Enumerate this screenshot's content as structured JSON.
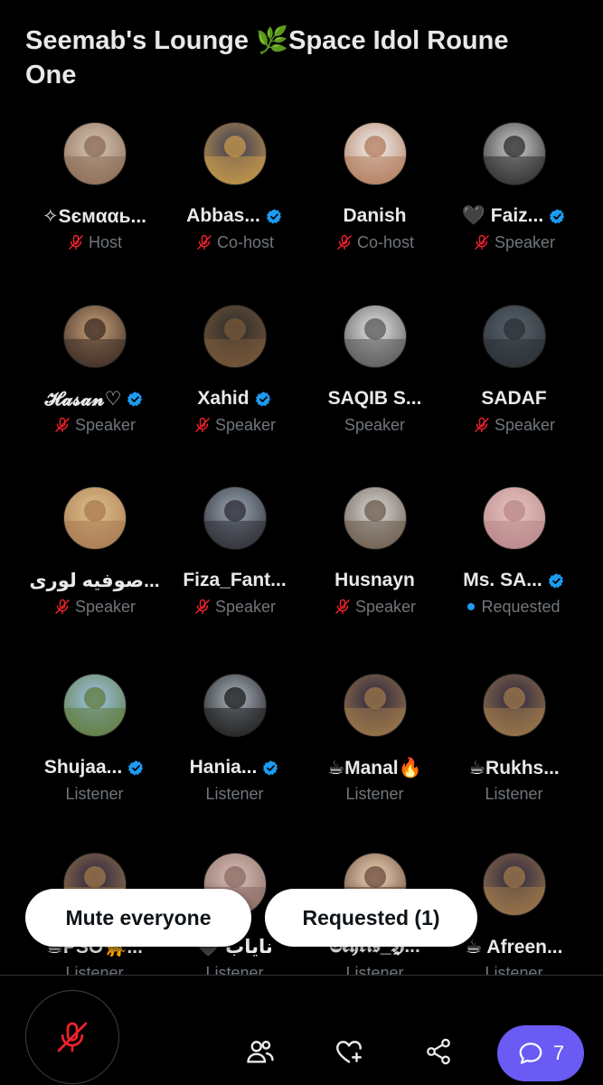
{
  "space": {
    "title": "Seemab's Lounge 🌿Space Idol Roune One"
  },
  "participants": [
    [
      {
        "name": "✧Ѕємααь...",
        "role": "Host",
        "verified": false,
        "status": "mic-off",
        "colors": [
          "#d8c7b6",
          "#8a6a54"
        ]
      },
      {
        "name": "Abbas...",
        "role": "Co-host",
        "verified": true,
        "status": "mic-off",
        "colors": [
          "#3a3a55",
          "#c89a4a"
        ]
      },
      {
        "name": "Danish",
        "role": "Co-host",
        "verified": false,
        "status": "mic-off",
        "colors": [
          "#f2f2f2",
          "#b07a5a"
        ]
      },
      {
        "name": "🖤 Faiz...",
        "role": "Speaker",
        "verified": true,
        "status": "mic-off",
        "colors": [
          "#d0d0d0",
          "#2a2a2a"
        ]
      }
    ],
    [
      {
        "name": "𝓗𝓪𝓼𝓪𝓷♡",
        "role": "Speaker",
        "verified": true,
        "status": "mic-off",
        "colors": [
          "#c9a27a",
          "#3a2a22"
        ]
      },
      {
        "name": "Xahid",
        "role": "Speaker",
        "verified": true,
        "status": "mic-off",
        "colors": [
          "#2b2b2b",
          "#7a5a3a"
        ]
      },
      {
        "name": "SAQIB S...",
        "role": "Speaker",
        "verified": false,
        "status": "none",
        "colors": [
          "#e6e6e6",
          "#555555"
        ]
      },
      {
        "name": "SADAF",
        "role": "Speaker",
        "verified": false,
        "status": "mic-off",
        "colors": [
          "#5a6570",
          "#2a2f33"
        ]
      }
    ],
    [
      {
        "name": "صوفيه لوری...",
        "role": "Speaker",
        "verified": false,
        "status": "mic-off",
        "colors": [
          "#e0c08a",
          "#a87a52"
        ]
      },
      {
        "name": "Fiza_Fant...",
        "role": "Speaker",
        "verified": false,
        "status": "mic-off",
        "colors": [
          "#9aa8b5",
          "#2b2b33"
        ]
      },
      {
        "name": "Husnayn",
        "role": "Speaker",
        "verified": false,
        "status": "mic-off",
        "colors": [
          "#d9d9d9",
          "#6a5a4a"
        ]
      },
      {
        "name": "Ms. SA...",
        "role": "Requested",
        "verified": true,
        "status": "requested",
        "colors": [
          "#e8c6c0",
          "#b8868a"
        ]
      }
    ],
    [
      {
        "name": "Shujaa...",
        "role": "Listener",
        "verified": true,
        "status": "none",
        "colors": [
          "#9ec4e8",
          "#5f7a3a"
        ]
      },
      {
        "name": "Hania...",
        "role": "Listener",
        "verified": true,
        "status": "none",
        "colors": [
          "#aeb7c2",
          "#1a1a1a"
        ]
      },
      {
        "name": "☕Manal🔥",
        "role": "Listener",
        "verified": false,
        "status": "none",
        "colors": [
          "#2a2540",
          "#a07a4a"
        ]
      },
      {
        "name": "☕Rukhs...",
        "role": "Listener",
        "verified": false,
        "status": "none",
        "colors": [
          "#2a2540",
          "#a07a4a"
        ]
      }
    ],
    [
      {
        "name": "☕PSO🐆...",
        "role": "Listener",
        "verified": false,
        "status": "none",
        "colors": [
          "#2a2540",
          "#a07a4a"
        ]
      },
      {
        "name": "🖤 نایاب",
        "role": "Listener",
        "verified": false,
        "status": "none",
        "colors": [
          "#d8c0b8",
          "#8a6a62"
        ]
      },
      {
        "name": "𝕾𝖊𝖍𝖗𝖎𝖘_𝕳...",
        "role": "Listener",
        "verified": false,
        "status": "none",
        "colors": [
          "#f0d6b8",
          "#6a4a3a"
        ]
      },
      {
        "name": "☕ Afreen...",
        "role": "Listener",
        "verified": false,
        "status": "none",
        "colors": [
          "#2a2540",
          "#a07a4a"
        ]
      }
    ]
  ],
  "actions": {
    "mute_everyone": "Mute everyone",
    "requested": "Requested (1)"
  },
  "bottom_bar": {
    "chat_count": "7"
  },
  "colors": {
    "accent_blue": "#1d9bf0",
    "mic_off_red": "#f4212e",
    "chat_purple": "#6b5bf5",
    "muted_text": "#71767b"
  },
  "icons": [
    "mic-off-icon",
    "verified-badge-icon",
    "people-icon",
    "heart-plus-icon",
    "share-icon",
    "chat-icon"
  ]
}
